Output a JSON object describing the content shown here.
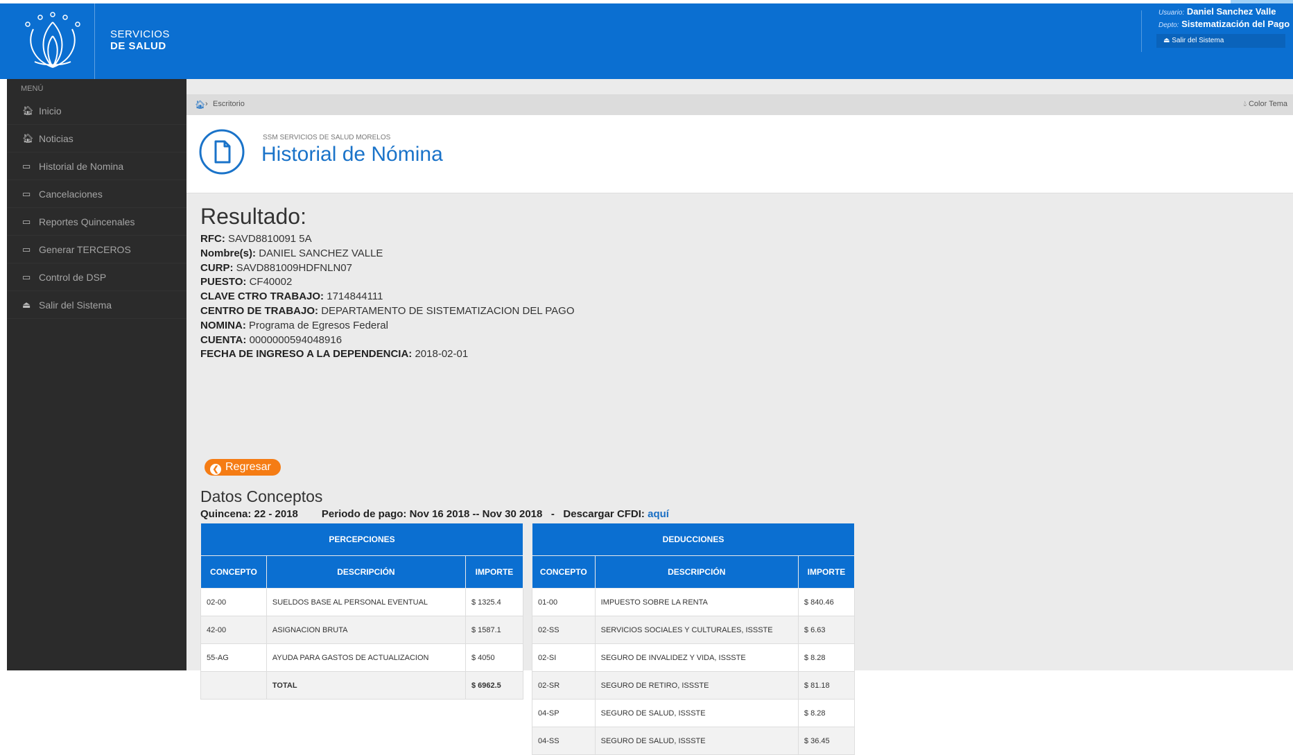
{
  "header": {
    "brand_line1": "SERVICIOS",
    "brand_line2": "DE SALUD",
    "user_label": "Usuario:",
    "user_name": "Daniel Sanchez Valle",
    "dept_label": "Depto:",
    "dept_name": "Sistematización del Pago",
    "logout_label": "Salir del Sistema",
    "brand_color": "#0b6fd1"
  },
  "sidebar": {
    "title": "MENÚ",
    "items": [
      {
        "label": "Inicio",
        "icon": "home-icon"
      },
      {
        "label": "Noticias",
        "icon": "home-icon"
      },
      {
        "label": "Historial de Nomina",
        "icon": "laptop-icon"
      },
      {
        "label": "Cancelaciones",
        "icon": "laptop-icon"
      },
      {
        "label": "Reportes Quincenales",
        "icon": "laptop-icon"
      },
      {
        "label": "Generar TERCEROS",
        "icon": "laptop-icon"
      },
      {
        "label": "Control de DSP",
        "icon": "laptop-icon"
      },
      {
        "label": "Salir del Sistema",
        "icon": "eject-icon"
      }
    ]
  },
  "breadcrumb": {
    "current": "Escritorio",
    "theme_button": "Color Tema"
  },
  "page": {
    "org": "SSM SERVICIOS DE SALUD MORELOS",
    "title": "Historial de Nómina"
  },
  "result": {
    "heading": "Resultado:",
    "fields": [
      {
        "label": "RFC:",
        "value": "SAVD8810091 5A"
      },
      {
        "label": "Nombre(s):",
        "value": "DANIEL SANCHEZ VALLE"
      },
      {
        "label": "CURP:",
        "value": "SAVD881009HDFNLN07"
      },
      {
        "label": "PUESTO:",
        "value": "CF40002"
      },
      {
        "label": "CLAVE CTRO TRABAJO:",
        "value": "1714844111"
      },
      {
        "label": "CENTRO DE TRABAJO:",
        "value": "DEPARTAMENTO DE SISTEMATIZACION DEL PAGO"
      },
      {
        "label": "NOMINA:",
        "value": "Programa de Egresos Federal"
      },
      {
        "label": "CUENTA:",
        "value": "0000000594048916"
      },
      {
        "label": "FECHA DE INGRESO A LA DEPENDENCIA:",
        "value": "2018-02-01"
      }
    ],
    "back_label": "Regresar"
  },
  "concepts": {
    "title": "Datos Conceptos",
    "quincena": "Quincena: 22 - 2018",
    "periodo": "Periodo de pago: Nov 16 2018 -- Nov 30 2018",
    "dash": "-",
    "cfdi_label": "Descargar CFDI:",
    "cfdi_link": "aquí",
    "percepciones": {
      "header": "PERCEPCIONES",
      "cols": [
        "CONCEPTO",
        "DESCRIPCIÓN",
        "IMPORTE"
      ],
      "rows": [
        [
          "02-00",
          "SUELDOS BASE AL PERSONAL EVENTUAL",
          "$ 1325.4"
        ],
        [
          "42-00",
          "ASIGNACION BRUTA",
          "$ 1587.1"
        ],
        [
          "55-AG",
          "AYUDA PARA GASTOS DE ACTUALIZACION",
          "$ 4050"
        ],
        [
          "",
          "TOTAL",
          "$ 6962.5"
        ]
      ]
    },
    "deducciones": {
      "header": "DEDUCCIONES",
      "cols": [
        "CONCEPTO",
        "DESCRIPCIÓN",
        "IMPORTE"
      ],
      "rows": [
        [
          "01-00",
          "IMPUESTO SOBRE LA RENTA",
          "$ 840.46"
        ],
        [
          "02-SS",
          "SERVICIOS SOCIALES Y CULTURALES, ISSSTE",
          "$ 6.63"
        ],
        [
          "02-SI",
          "SEGURO DE INVALIDEZ Y VIDA, ISSSTE",
          "$ 8.28"
        ],
        [
          "02-SR",
          "SEGURO DE RETIRO, ISSSTE",
          "$ 81.18"
        ],
        [
          "04-SP",
          "SEGURO DE SALUD, ISSSTE",
          "$ 8.28"
        ],
        [
          "04-SS",
          "SEGURO DE SALUD, ISSSTE",
          "$ 36.45"
        ]
      ]
    }
  }
}
